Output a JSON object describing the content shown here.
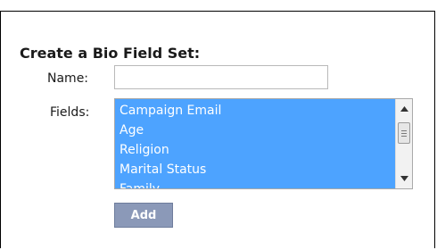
{
  "form": {
    "title": "Create a Bio Field Set:",
    "name_label": "Name:",
    "name_value": "",
    "fields_label": "Fields:",
    "fields_options": [
      "Campaign Email",
      "Age",
      "Religion",
      "Marital Status",
      "Family"
    ],
    "add_label": "Add"
  },
  "colors": {
    "selection": "#4da3ff",
    "button": "#8b99b8",
    "border": "#000000"
  },
  "icons": {
    "scroll_up": "triangle-up-icon",
    "scroll_down": "triangle-down-icon"
  }
}
